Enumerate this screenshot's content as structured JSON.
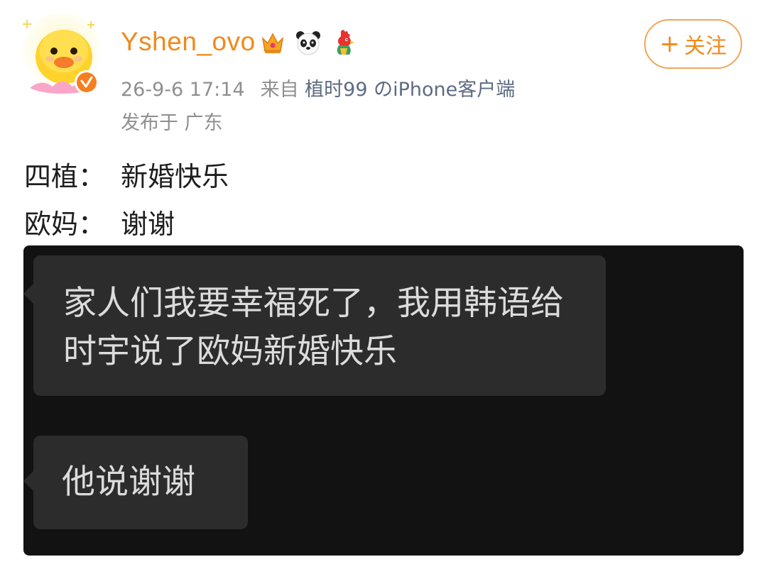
{
  "post": {
    "username": "Yshen_ovo",
    "badge_icons": [
      "crown-icon",
      "panda-icon",
      "rooster-icon"
    ],
    "follow_label": "关注",
    "follow_plus": "+",
    "timestamp": "26-9-6 17:14",
    "source_prefix": "来自",
    "source_link": "植时99 のiPhone客户端",
    "location": "发布于 广东",
    "lines": [
      {
        "speaker": "四植：",
        "text": "新婚快乐"
      },
      {
        "speaker": "欧妈：",
        "text": "谢谢"
      }
    ]
  },
  "chat": {
    "messages": [
      "家人们我要幸福死了，我用韩语给时宇说了欧妈新婚快乐",
      "他说谢谢"
    ]
  },
  "colors": {
    "username": "#f08a1c",
    "follow_border": "#f0a65a",
    "meta_gray": "#8f8f8f",
    "source_link": "#5e6b82",
    "chat_bg": "#121212",
    "bubble_bg": "#2c2c2c"
  }
}
